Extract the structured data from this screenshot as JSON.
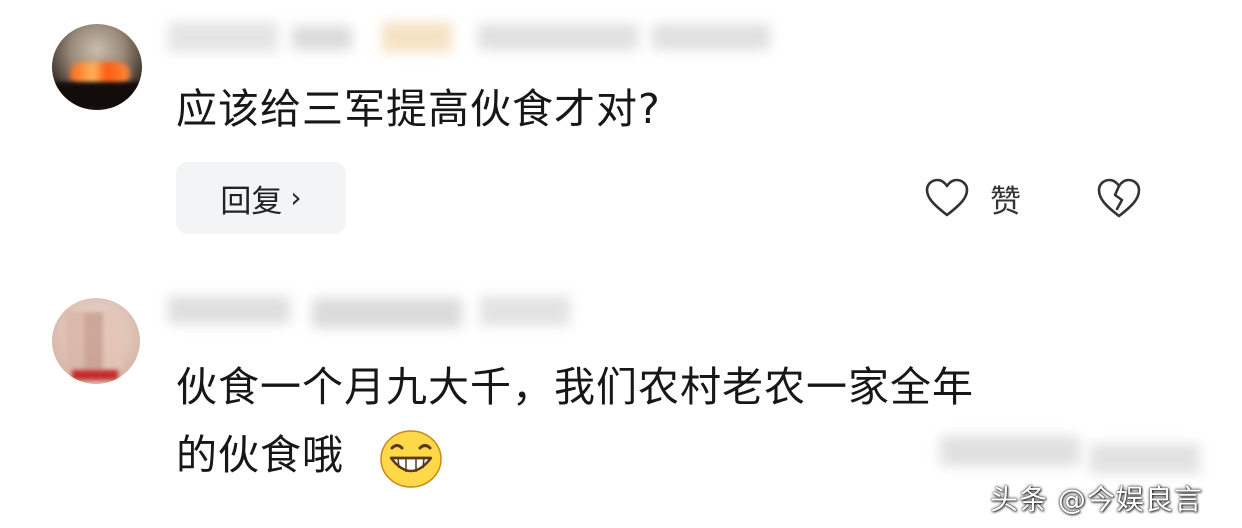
{
  "comments": [
    {
      "text": "应该给三军提高伙食才对?",
      "actions": {
        "reply_label": "回复",
        "reply_chevron": "›",
        "like_label": "赞",
        "like_icon": "heart-outline-icon",
        "dislike_icon": "broken-heart-icon"
      }
    },
    {
      "text_line1": "伙食一个月九大千，我们农村老农一家全年",
      "text_line2": "的伙食哦",
      "emoji": "grinning-face-emoji"
    }
  ],
  "watermark": "头条 @今娱良言",
  "colors": {
    "reply_bg": "#f3f4f6",
    "text": "#171717",
    "icon": "#333333",
    "emoji_face": "#ffd84a"
  }
}
